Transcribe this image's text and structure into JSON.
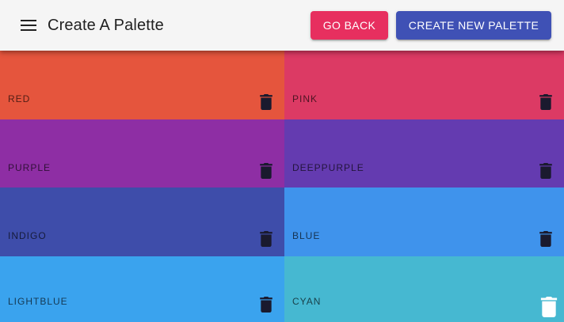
{
  "header": {
    "title": "Create A Palette",
    "go_back_label": "GO BACK",
    "create_label": "CREATE NEW PALETTE"
  },
  "colors": {
    "accent_pink": "#e72f5f",
    "accent_indigo": "#3f51b5"
  },
  "palette": [
    {
      "name": "RED",
      "color": "#e5553d",
      "icon": "trash-icon"
    },
    {
      "name": "PINK",
      "color": "#dc3a64",
      "icon": "trash-icon"
    },
    {
      "name": "PURPLE",
      "color": "#8e2ea4",
      "icon": "trash-icon"
    },
    {
      "name": "DEEPPURPLE",
      "color": "#643bb0",
      "icon": "trash-icon"
    },
    {
      "name": "INDIGO",
      "color": "#3e4daa",
      "icon": "trash-icon"
    },
    {
      "name": "BLUE",
      "color": "#3f93ec",
      "icon": "trash-icon"
    },
    {
      "name": "LIGHTBLUE",
      "color": "#3aa3ee",
      "icon": "trash-icon"
    },
    {
      "name": "CYAN",
      "color": "#46b8d1",
      "icon": "trash-icon-white"
    }
  ]
}
